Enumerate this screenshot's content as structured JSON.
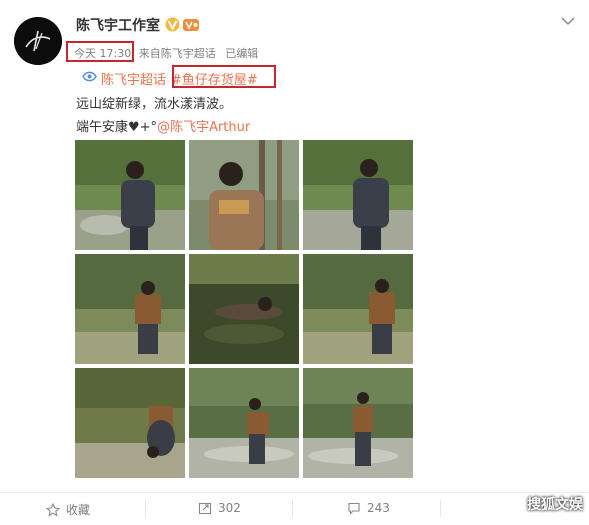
{
  "post": {
    "author": "陈飞宇工作室",
    "time": "今天 17:30",
    "from_word": "来自",
    "source": "陈飞宇超话",
    "edited": "已编辑",
    "super_topic": "陈飞宇超话",
    "hashtag": "#鱼仔存货屋#",
    "line1": "远山绽新绿，流水漾清波。",
    "line2_prefix": "端午安康♥+°",
    "mention": "@陈飞宇Arthur",
    "photos": [
      {
        "name": "photo-1"
      },
      {
        "name": "photo-2"
      },
      {
        "name": "photo-3"
      },
      {
        "name": "photo-4"
      },
      {
        "name": "photo-5"
      },
      {
        "name": "photo-6"
      },
      {
        "name": "photo-7"
      },
      {
        "name": "photo-8"
      },
      {
        "name": "photo-9"
      }
    ]
  },
  "actions": {
    "favorite_label": "收藏",
    "repost_count": "302",
    "comment_count": "",
    "like_count": "243"
  },
  "watermark": "搜狐文娱",
  "icons": {
    "verified": "verified-badge-icon",
    "member": "vip-member-icon",
    "more": "chevron-down-icon",
    "super_topic": "super-topic-icon",
    "favorite": "star-icon",
    "repost": "repost-icon",
    "comment": "comment-icon",
    "like": "thumbs-up-icon"
  },
  "colors": {
    "accent": "#eb7350",
    "highlight_box": "#c8262e",
    "verified": "#f6b73c"
  }
}
